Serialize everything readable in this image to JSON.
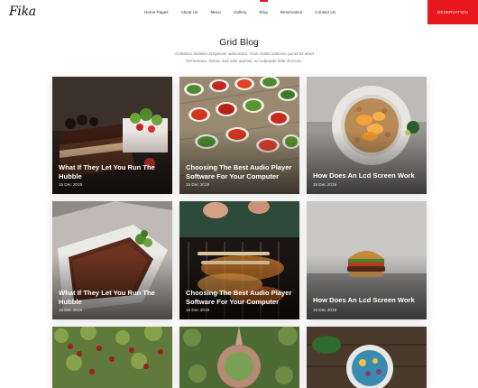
{
  "brand": {
    "logo": "Fika",
    "accent": "#e8161d"
  },
  "nav": {
    "items": [
      {
        "label": "Home Pages"
      },
      {
        "label": "About Us"
      },
      {
        "label": "Menu"
      },
      {
        "label": "Gallery"
      },
      {
        "label": "Blog",
        "active": true
      },
      {
        "label": "Reservation"
      },
      {
        "label": "Contact Us"
      }
    ],
    "cta": "RESERVATION"
  },
  "page": {
    "title": "Grid Blog",
    "subtitle": "Ambitioni dedisse scripsisse iudicaretur. Cras mattis iudicium purus sit amet fermentum. Donec sed odio operae, eu vulputate felis rhoncus."
  },
  "posts": [
    {
      "title": "What If They Let You Run The Hubble",
      "date": "15 Dec 2019",
      "image": "chocolate-cake-strawberries"
    },
    {
      "title": "Choosing The Best Audio Player Software For Your Computer",
      "date": "15 Dec 2019",
      "image": "spice-bowls"
    },
    {
      "title": "How Does An Lcd Screen Work",
      "date": "15 Dec 2019",
      "image": "peach-granola-plate"
    },
    {
      "title": "What If They Let You Run The Hubble",
      "date": "15 Dec 2019",
      "image": "chocolate-tart-mint"
    },
    {
      "title": "Choosing The Best Audio Player Software For Your Computer",
      "date": "15 Dec 2019",
      "image": "grill-skewers"
    },
    {
      "title": "How Does An Lcd Screen Work",
      "date": "15 Dec 2019",
      "image": "burger"
    },
    {
      "title": "",
      "date": "",
      "image": "berry-bush"
    },
    {
      "title": "",
      "date": "",
      "image": "garden-aerial"
    },
    {
      "title": "",
      "date": "",
      "image": "smoothie-bowl"
    }
  ]
}
